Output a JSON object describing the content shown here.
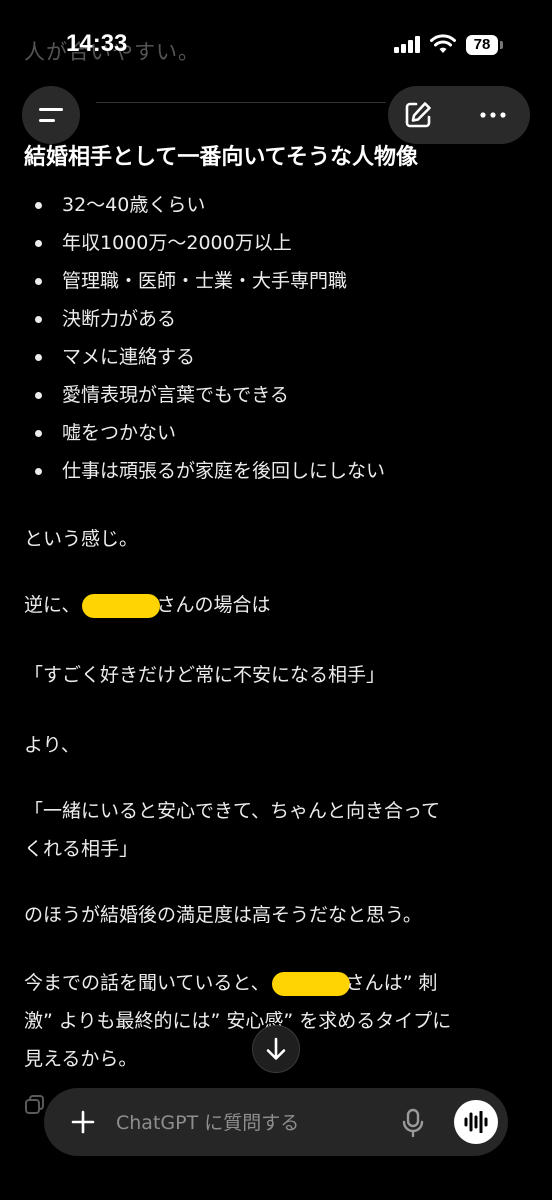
{
  "status": {
    "time": "14:33",
    "battery": "78"
  },
  "faded_previous_text": "人が合いやすい。",
  "heading": "結婚相手として一番向いてそうな人物像",
  "traits": [
    "32〜40歳くらい",
    "年収1000万〜2000万以上",
    "管理職・医師・士業・大手専門職",
    "決断力がある",
    "マメに連絡する",
    "愛情表現が言葉でもできる",
    "嘘をつかない",
    "仕事は頑張るが家庭を後回しにしない"
  ],
  "paragraphs": {
    "p1": "という感じ。",
    "p2_before": "逆に、",
    "p2_after": "さんの場合は",
    "p3": "「すごく好きだけど常に不安になる相手」",
    "p4": "より、",
    "p5_line1": "「一緒にいると安心できて、ちゃんと向き合って",
    "p5_line2": "くれる相手」",
    "p6": "のほうが結婚後の満足度は高そうだなと思う。",
    "p7_before": "今までの話を聞いていると、",
    "p7_after": "さんは” 刺",
    "p7_line2": "激” よりも最終的には” 安心感” を求めるタイプに",
    "p7_line3": "見えるから。"
  },
  "composer": {
    "placeholder": "ChatGPT に質問する"
  },
  "colors": {
    "background": "#000000",
    "redaction": "#ffd400",
    "pill": "#2a2a2a"
  },
  "icons": [
    "menu-icon",
    "edit-icon",
    "more-icon",
    "arrow-down-icon",
    "copy-icon",
    "plus-icon",
    "mic-icon",
    "voice-wave-icon"
  ]
}
